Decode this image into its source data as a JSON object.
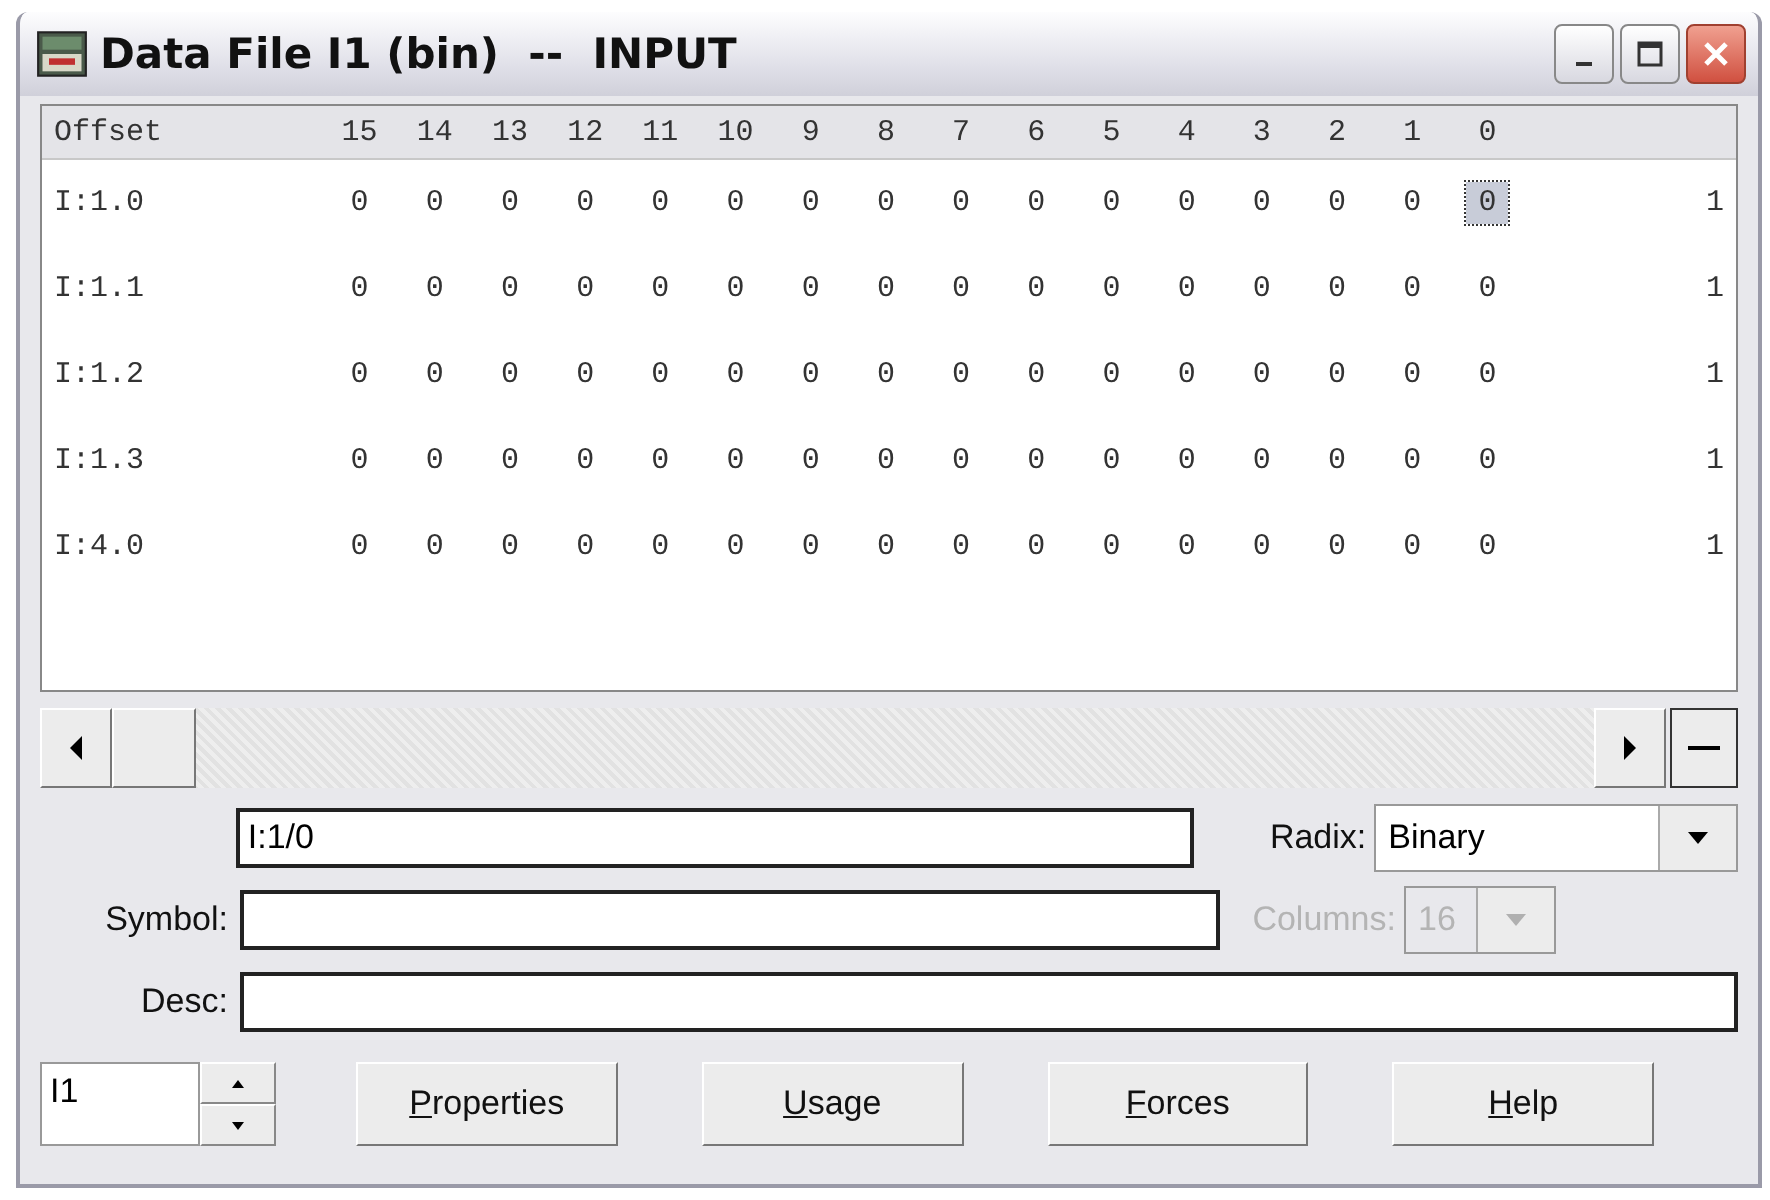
{
  "window": {
    "title": "Data File I1 (bin)  --  INPUT"
  },
  "table": {
    "columns": [
      "Offset",
      "15",
      "14",
      "13",
      "12",
      "11",
      "10",
      "9",
      "8",
      "7",
      "6",
      "5",
      "4",
      "3",
      "2",
      "1",
      "0"
    ],
    "rows": [
      {
        "cells": [
          {
            "text": "I:1.0",
            "selected": false
          },
          {
            "text": "0",
            "selected": false
          },
          {
            "text": "0",
            "selected": false
          },
          {
            "text": "0",
            "selected": false
          },
          {
            "text": "0",
            "selected": false
          },
          {
            "text": "0",
            "selected": false
          },
          {
            "text": "0",
            "selected": false
          },
          {
            "text": "0",
            "selected": false
          },
          {
            "text": "0",
            "selected": false
          },
          {
            "text": "0",
            "selected": false
          },
          {
            "text": "0",
            "selected": false
          },
          {
            "text": "0",
            "selected": false
          },
          {
            "text": "0",
            "selected": false
          },
          {
            "text": "0",
            "selected": false
          },
          {
            "text": "0",
            "selected": false
          },
          {
            "text": "0",
            "selected": false
          },
          {
            "text": "0",
            "selected": true
          },
          {
            "text": "1",
            "selected": false
          }
        ]
      },
      {
        "cells": [
          {
            "text": "I:1.1",
            "selected": false
          },
          {
            "text": "0",
            "selected": false
          },
          {
            "text": "0",
            "selected": false
          },
          {
            "text": "0",
            "selected": false
          },
          {
            "text": "0",
            "selected": false
          },
          {
            "text": "0",
            "selected": false
          },
          {
            "text": "0",
            "selected": false
          },
          {
            "text": "0",
            "selected": false
          },
          {
            "text": "0",
            "selected": false
          },
          {
            "text": "0",
            "selected": false
          },
          {
            "text": "0",
            "selected": false
          },
          {
            "text": "0",
            "selected": false
          },
          {
            "text": "0",
            "selected": false
          },
          {
            "text": "0",
            "selected": false
          },
          {
            "text": "0",
            "selected": false
          },
          {
            "text": "0",
            "selected": false
          },
          {
            "text": "0",
            "selected": false
          },
          {
            "text": "1",
            "selected": false
          }
        ]
      },
      {
        "cells": [
          {
            "text": "I:1.2",
            "selected": false
          },
          {
            "text": "0",
            "selected": false
          },
          {
            "text": "0",
            "selected": false
          },
          {
            "text": "0",
            "selected": false
          },
          {
            "text": "0",
            "selected": false
          },
          {
            "text": "0",
            "selected": false
          },
          {
            "text": "0",
            "selected": false
          },
          {
            "text": "0",
            "selected": false
          },
          {
            "text": "0",
            "selected": false
          },
          {
            "text": "0",
            "selected": false
          },
          {
            "text": "0",
            "selected": false
          },
          {
            "text": "0",
            "selected": false
          },
          {
            "text": "0",
            "selected": false
          },
          {
            "text": "0",
            "selected": false
          },
          {
            "text": "0",
            "selected": false
          },
          {
            "text": "0",
            "selected": false
          },
          {
            "text": "0",
            "selected": false
          },
          {
            "text": "1",
            "selected": false
          }
        ]
      },
      {
        "cells": [
          {
            "text": "I:1.3",
            "selected": false
          },
          {
            "text": "0",
            "selected": false
          },
          {
            "text": "0",
            "selected": false
          },
          {
            "text": "0",
            "selected": false
          },
          {
            "text": "0",
            "selected": false
          },
          {
            "text": "0",
            "selected": false
          },
          {
            "text": "0",
            "selected": false
          },
          {
            "text": "0",
            "selected": false
          },
          {
            "text": "0",
            "selected": false
          },
          {
            "text": "0",
            "selected": false
          },
          {
            "text": "0",
            "selected": false
          },
          {
            "text": "0",
            "selected": false
          },
          {
            "text": "0",
            "selected": false
          },
          {
            "text": "0",
            "selected": false
          },
          {
            "text": "0",
            "selected": false
          },
          {
            "text": "0",
            "selected": false
          },
          {
            "text": "0",
            "selected": false
          },
          {
            "text": "1",
            "selected": false
          }
        ]
      },
      {
        "cells": [
          {
            "text": "I:4.0",
            "selected": false
          },
          {
            "text": "0",
            "selected": false
          },
          {
            "text": "0",
            "selected": false
          },
          {
            "text": "0",
            "selected": false
          },
          {
            "text": "0",
            "selected": false
          },
          {
            "text": "0",
            "selected": false
          },
          {
            "text": "0",
            "selected": false
          },
          {
            "text": "0",
            "selected": false
          },
          {
            "text": "0",
            "selected": false
          },
          {
            "text": "0",
            "selected": false
          },
          {
            "text": "0",
            "selected": false
          },
          {
            "text": "0",
            "selected": false
          },
          {
            "text": "0",
            "selected": false
          },
          {
            "text": "0",
            "selected": false
          },
          {
            "text": "0",
            "selected": false
          },
          {
            "text": "0",
            "selected": false
          },
          {
            "text": "0",
            "selected": false
          },
          {
            "text": "1",
            "selected": false
          }
        ]
      }
    ]
  },
  "address": {
    "value": "I:1/0"
  },
  "radix": {
    "label": "Radix:",
    "value": "Binary"
  },
  "symbol": {
    "label": "Symbol:"
  },
  "columns_select": {
    "label": "Columns:",
    "value": "16",
    "disabled": true
  },
  "desc": {
    "label": "Desc:"
  },
  "file_field": {
    "value": "I1"
  },
  "buttons": [
    {
      "accel": "P",
      "rest": "roperties"
    },
    {
      "accel": "U",
      "rest": "sage"
    },
    {
      "accel": "F",
      "rest": "orces"
    },
    {
      "accel": "H",
      "rest": "elp"
    }
  ]
}
